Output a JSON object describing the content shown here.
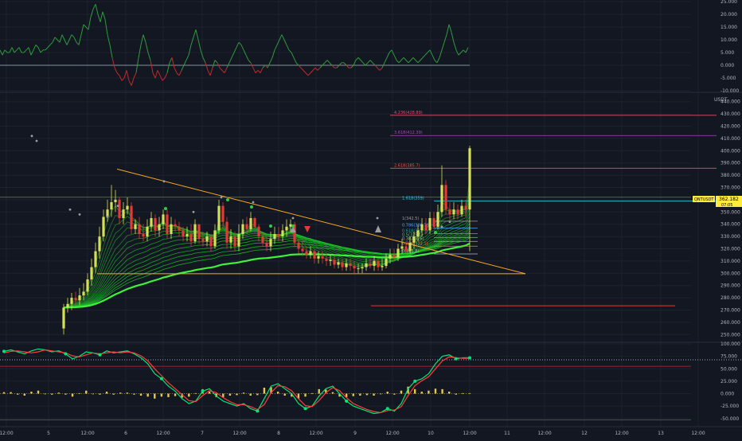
{
  "colors": {
    "background": "#131722",
    "grid": "#1e2230",
    "axis_text": "#b2b5be",
    "candle_up": "#d4e157",
    "candle_down": "#e53935",
    "ribbon": "#43d33f",
    "trend": "#f5a623",
    "osc_line": "#2e9b3a",
    "osc_neg": "#c62828",
    "price_tag": "#ffeb3b",
    "price_tag_text": "#000000",
    "stoch_fast": "#00e676",
    "stoch_slow": "#ff3d3d",
    "hist": "#e6c84b"
  },
  "axis": {
    "currency": "USDT",
    "x_ticks": [
      "12:00",
      "5",
      "12:00",
      "6",
      "12:00",
      "7",
      "12:00",
      "8",
      "12:00",
      "9",
      "12:00",
      "10",
      "12:00",
      "11",
      "12:00",
      "12",
      "12:00",
      "13",
      "12:00"
    ],
    "top_ticks": [
      "25.000",
      "20.000",
      "15.000",
      "10.000",
      "5.000",
      "0.000",
      "-5.000",
      "-10.000"
    ],
    "price_ticks": [
      "440.000",
      "430.000",
      "420.000",
      "410.000",
      "400.000",
      "390.000",
      "380.000",
      "370.000",
      "360.000",
      "350.000",
      "340.000",
      "330.000",
      "320.000",
      "310.000",
      "300.000",
      "290.000",
      "280.000",
      "270.000",
      "260.000",
      "250.000"
    ],
    "bottom_ticks": [
      "100.000",
      "75.000",
      "50.000",
      "25.000",
      "0.000",
      "-25.000",
      "-50.000"
    ]
  },
  "price_tag": {
    "symbol": "QNTUSDT",
    "value": "362.182",
    "time": "07:05"
  },
  "fib_levels": [
    {
      "label": "4.236(428.89)",
      "value": 428.89,
      "color": "#e84b6a"
    },
    {
      "label": "3.618(412.39)",
      "value": 412.39,
      "color": "#ab47bc"
    },
    {
      "label": "2.618(385.7)",
      "value": 385.7,
      "color": "#ef5350"
    },
    {
      "label": "1.618(359)",
      "value": 359.0,
      "color": "#26c6da"
    },
    {
      "label": "1(342.5)",
      "value": 342.5,
      "color": "#9e9e9e"
    },
    {
      "label": "0.786(336.78)",
      "value": 336.78,
      "color": "#42a5f5"
    },
    {
      "label": "0.618(332.3)",
      "value": 332.3,
      "color": "#26a69a"
    },
    {
      "label": "0.5(329.1)",
      "value": 329.1,
      "color": "#66bb6a"
    },
    {
      "label": "0.382(326)",
      "value": 326.0,
      "color": "#81c784"
    },
    {
      "label": "0.236(322.1)",
      "value": 322.1,
      "color": "#ff7043"
    },
    {
      "label": "0(315.8)",
      "value": 315.8,
      "color": "#b0bec5"
    }
  ],
  "chart_data": [
    {
      "type": "line",
      "panel": "top-oscillator",
      "ylim": [
        -10,
        25
      ],
      "x": [
        0,
        3,
        6,
        9,
        12,
        15,
        18,
        21,
        24,
        27,
        30,
        33,
        36,
        39,
        42,
        45,
        48,
        51,
        54,
        57,
        60,
        63,
        66,
        69,
        72,
        75,
        78,
        81,
        84,
        87,
        90,
        93,
        96,
        99,
        102,
        105,
        108,
        111,
        114,
        117,
        120,
        123,
        126,
        129,
        132,
        135,
        138,
        141,
        144,
        147,
        150,
        153,
        156,
        159,
        162,
        165,
        168,
        171,
        174,
        177,
        180,
        183,
        186,
        189,
        192,
        195,
        198,
        201,
        204,
        207,
        210,
        213,
        216,
        219,
        222,
        225,
        228,
        231,
        234,
        237,
        240,
        243,
        246,
        249,
        252,
        255,
        258,
        261,
        264,
        267,
        270,
        273,
        276,
        279,
        282,
        285,
        288,
        291,
        294,
        297,
        300,
        303,
        306,
        309,
        312,
        315,
        318,
        321,
        324,
        327,
        330,
        333,
        336,
        339,
        342,
        345,
        348,
        351,
        354,
        357,
        360,
        363,
        366,
        369,
        372,
        375,
        378,
        381,
        384,
        387,
        390,
        393,
        396,
        399,
        402,
        405,
        408,
        411,
        414,
        417,
        420,
        423,
        426,
        429,
        432,
        435,
        438,
        441,
        444,
        447,
        450,
        453,
        456,
        459,
        462,
        465,
        468,
        471,
        474,
        477,
        480,
        483,
        486,
        489,
        492,
        495,
        498,
        501,
        504,
        507,
        510,
        513,
        516,
        519,
        522,
        525,
        528,
        531,
        534,
        537,
        540,
        543,
        546,
        549,
        552,
        555,
        558,
        561,
        564,
        567,
        570,
        573,
        576,
        579,
        582,
        585,
        588
      ],
      "values": [
        6,
        4,
        6,
        5,
        5,
        7,
        5,
        6,
        7,
        5,
        5,
        6,
        7,
        4,
        6,
        8,
        7,
        5,
        6,
        6,
        7,
        8,
        9,
        11,
        10,
        9,
        12,
        10,
        8,
        10,
        12,
        11,
        9,
        8,
        12,
        16,
        15,
        14,
        19,
        22,
        24,
        20,
        17,
        21,
        18,
        12,
        8,
        3,
        -1,
        -3,
        -4,
        -6,
        -5,
        -2,
        -6,
        -8,
        -5,
        -3,
        3,
        8,
        12,
        9,
        5,
        2,
        -3,
        -5,
        -2,
        -4,
        -6,
        -5,
        -3,
        1,
        3,
        -1,
        -3,
        -4,
        -2,
        0,
        2,
        4,
        8,
        11,
        14,
        10,
        6,
        3,
        1,
        -2,
        -4,
        -1,
        2,
        1,
        -1,
        -2,
        -3,
        -1,
        1,
        3,
        5,
        7,
        9,
        8,
        6,
        4,
        2,
        1,
        -1,
        -3,
        -2,
        -3,
        -1,
        0,
        -1,
        1,
        3,
        6,
        8,
        10,
        12,
        10,
        8,
        6,
        5,
        3,
        1,
        0,
        -1,
        -2,
        -3,
        -4,
        -3,
        -2,
        -1,
        -2,
        -1,
        0,
        1,
        2,
        1,
        0,
        -1,
        -1,
        0,
        1,
        1,
        0,
        -1,
        -1,
        0,
        2,
        3,
        2,
        1,
        0,
        1,
        2,
        1,
        0,
        -1,
        -2,
        -1,
        1,
        3,
        5,
        6,
        4,
        2,
        1,
        2,
        3,
        2,
        1,
        2,
        3,
        2,
        1,
        2,
        3,
        4,
        5,
        6,
        4,
        2,
        1,
        3,
        6,
        9,
        12,
        16,
        13,
        9,
        6,
        4,
        5,
        6,
        5,
        7
      ]
    },
    {
      "type": "candlestick",
      "panel": "main",
      "ylabel": "USDT",
      "ylim": [
        245,
        445
      ],
      "note_trend": "symmetrical triangle",
      "x": [
        80,
        85,
        90,
        95,
        100,
        105,
        110,
        115,
        120,
        125,
        130,
        135,
        140,
        145,
        150,
        155,
        160,
        165,
        170,
        175,
        180,
        185,
        190,
        195,
        200,
        205,
        210,
        215,
        220,
        225,
        230,
        235,
        240,
        245,
        250,
        255,
        260,
        265,
        270,
        275,
        280,
        285,
        290,
        295,
        300,
        305,
        310,
        315,
        320,
        325,
        330,
        335,
        340,
        345,
        350,
        355,
        360,
        365,
        370,
        375,
        380,
        385,
        390,
        395,
        400,
        405,
        410,
        415,
        420,
        425,
        430,
        435,
        440,
        445,
        450,
        455,
        460,
        465,
        470,
        475,
        480,
        485,
        490,
        495,
        500,
        505,
        510,
        515,
        520,
        525,
        530,
        535,
        540,
        545,
        550,
        555,
        560,
        565,
        570,
        575,
        580,
        585,
        590
      ],
      "open": [
        255,
        272,
        275,
        280,
        278,
        282,
        285,
        295,
        305,
        318,
        330,
        346,
        352,
        358,
        360,
        345,
        352,
        355,
        336,
        340,
        332,
        330,
        338,
        345,
        335,
        340,
        348,
        332,
        340,
        338,
        335,
        330,
        332,
        326,
        340,
        328,
        326,
        330,
        322,
        335,
        355,
        342,
        325,
        330,
        322,
        332,
        340,
        336,
        345,
        338,
        330,
        325,
        322,
        328,
        332,
        330,
        335,
        338,
        340,
        325,
        320,
        318,
        315,
        318,
        312,
        314,
        312,
        310,
        311,
        307,
        309,
        305,
        308,
        306,
        304,
        304,
        305,
        308,
        306,
        310,
        305,
        306,
        312,
        315,
        313,
        320,
        322,
        318,
        325,
        330,
        335,
        340,
        335,
        345,
        338,
        350,
        372,
        352,
        348,
        352,
        348,
        355,
        352
      ],
      "close": [
        272,
        275,
        280,
        278,
        282,
        285,
        295,
        305,
        318,
        330,
        346,
        352,
        358,
        360,
        345,
        352,
        355,
        336,
        340,
        332,
        330,
        338,
        345,
        335,
        340,
        348,
        332,
        340,
        338,
        335,
        330,
        332,
        326,
        340,
        328,
        326,
        330,
        322,
        335,
        355,
        342,
        325,
        330,
        322,
        332,
        340,
        336,
        345,
        338,
        330,
        325,
        322,
        328,
        332,
        330,
        335,
        338,
        340,
        325,
        320,
        318,
        315,
        318,
        312,
        314,
        312,
        310,
        311,
        307,
        309,
        305,
        308,
        306,
        304,
        304,
        305,
        308,
        306,
        310,
        305,
        306,
        312,
        315,
        313,
        320,
        322,
        318,
        325,
        330,
        335,
        340,
        335,
        345,
        338,
        350,
        372,
        352,
        348,
        352,
        348,
        355,
        352,
        402
      ],
      "high": [
        275,
        280,
        284,
        285,
        288,
        292,
        300,
        312,
        325,
        338,
        352,
        360,
        372,
        368,
        362,
        358,
        362,
        358,
        344,
        346,
        340,
        344,
        350,
        348,
        346,
        352,
        352,
        346,
        344,
        342,
        338,
        338,
        340,
        344,
        338,
        334,
        334,
        332,
        340,
        360,
        358,
        346,
        336,
        334,
        340,
        344,
        346,
        350,
        346,
        340,
        334,
        330,
        334,
        338,
        338,
        340,
        344,
        344,
        342,
        328,
        326,
        322,
        322,
        320,
        318,
        318,
        316,
        315,
        314,
        312,
        312,
        312,
        312,
        310,
        308,
        308,
        312,
        312,
        314,
        312,
        312,
        316,
        320,
        320,
        324,
        328,
        326,
        330,
        334,
        340,
        345,
        345,
        350,
        350,
        356,
        388,
        376,
        358,
        358,
        356,
        360,
        360,
        404
      ],
      "low": [
        250,
        268,
        270,
        274,
        274,
        278,
        282,
        290,
        300,
        312,
        326,
        342,
        346,
        350,
        340,
        340,
        348,
        332,
        332,
        328,
        326,
        326,
        334,
        330,
        330,
        336,
        328,
        328,
        334,
        330,
        326,
        326,
        322,
        324,
        324,
        322,
        322,
        318,
        320,
        332,
        336,
        320,
        320,
        318,
        318,
        328,
        332,
        334,
        336,
        326,
        322,
        318,
        318,
        324,
        326,
        326,
        330,
        334,
        322,
        316,
        314,
        312,
        312,
        308,
        308,
        308,
        306,
        306,
        304,
        304,
        302,
        302,
        302,
        300,
        300,
        300,
        302,
        304,
        302,
        302,
        302,
        304,
        308,
        310,
        310,
        316,
        316,
        316,
        320,
        326,
        330,
        332,
        332,
        336,
        336,
        346,
        348,
        344,
        344,
        344,
        346,
        346,
        318
      ]
    },
    {
      "type": "line",
      "panel": "bottom-oscillator",
      "ylim": [
        -60,
        100
      ],
      "series": [
        {
          "role": "fast",
          "values": [
            85,
            88,
            84,
            80,
            86,
            90,
            88,
            84,
            86,
            80,
            70,
            75,
            84,
            82,
            78,
            86,
            82,
            84,
            86,
            80,
            72,
            60,
            40,
            30,
            15,
            5,
            -10,
            -20,
            -15,
            5,
            10,
            -5,
            -15,
            -20,
            -25,
            -20,
            -30,
            -35,
            -10,
            15,
            20,
            10,
            0,
            -20,
            -30,
            -25,
            -5,
            10,
            15,
            0,
            -15,
            -25,
            -30,
            -35,
            -40,
            -38,
            -30,
            -35,
            -20,
            10,
            25,
            30,
            40,
            60,
            75,
            78,
            70,
            72,
            72
          ]
        },
        {
          "role": "slow",
          "values": [
            82,
            85,
            86,
            84,
            82,
            84,
            88,
            86,
            84,
            82,
            76,
            74,
            78,
            82,
            80,
            82,
            84,
            82,
            84,
            82,
            76,
            66,
            50,
            36,
            22,
            10,
            -2,
            -14,
            -16,
            -4,
            6,
            2,
            -8,
            -16,
            -22,
            -22,
            -26,
            -32,
            -22,
            2,
            16,
            14,
            6,
            -10,
            -24,
            -26,
            -14,
            2,
            12,
            6,
            -8,
            -20,
            -26,
            -32,
            -36,
            -38,
            -34,
            -33,
            -26,
            -4,
            16,
            26,
            34,
            50,
            66,
            74,
            72,
            71,
            71
          ]
        }
      ],
      "hist": [
        3,
        3,
        -2,
        -4,
        4,
        6,
        0,
        -2,
        2,
        -2,
        -6,
        1,
        6,
        0,
        -2,
        4,
        -2,
        2,
        2,
        -2,
        -4,
        -6,
        -10,
        -6,
        -7,
        -5,
        -8,
        -6,
        1,
        9,
        4,
        -7,
        -7,
        -4,
        -3,
        2,
        -4,
        -3,
        12,
        13,
        4,
        -4,
        -6,
        -10,
        -6,
        1,
        9,
        8,
        3,
        -6,
        -7,
        -5,
        -4,
        -3,
        -4,
        0,
        4,
        -2,
        6,
        14,
        9,
        4,
        6,
        10,
        9,
        4,
        -2,
        1,
        1
      ]
    }
  ]
}
